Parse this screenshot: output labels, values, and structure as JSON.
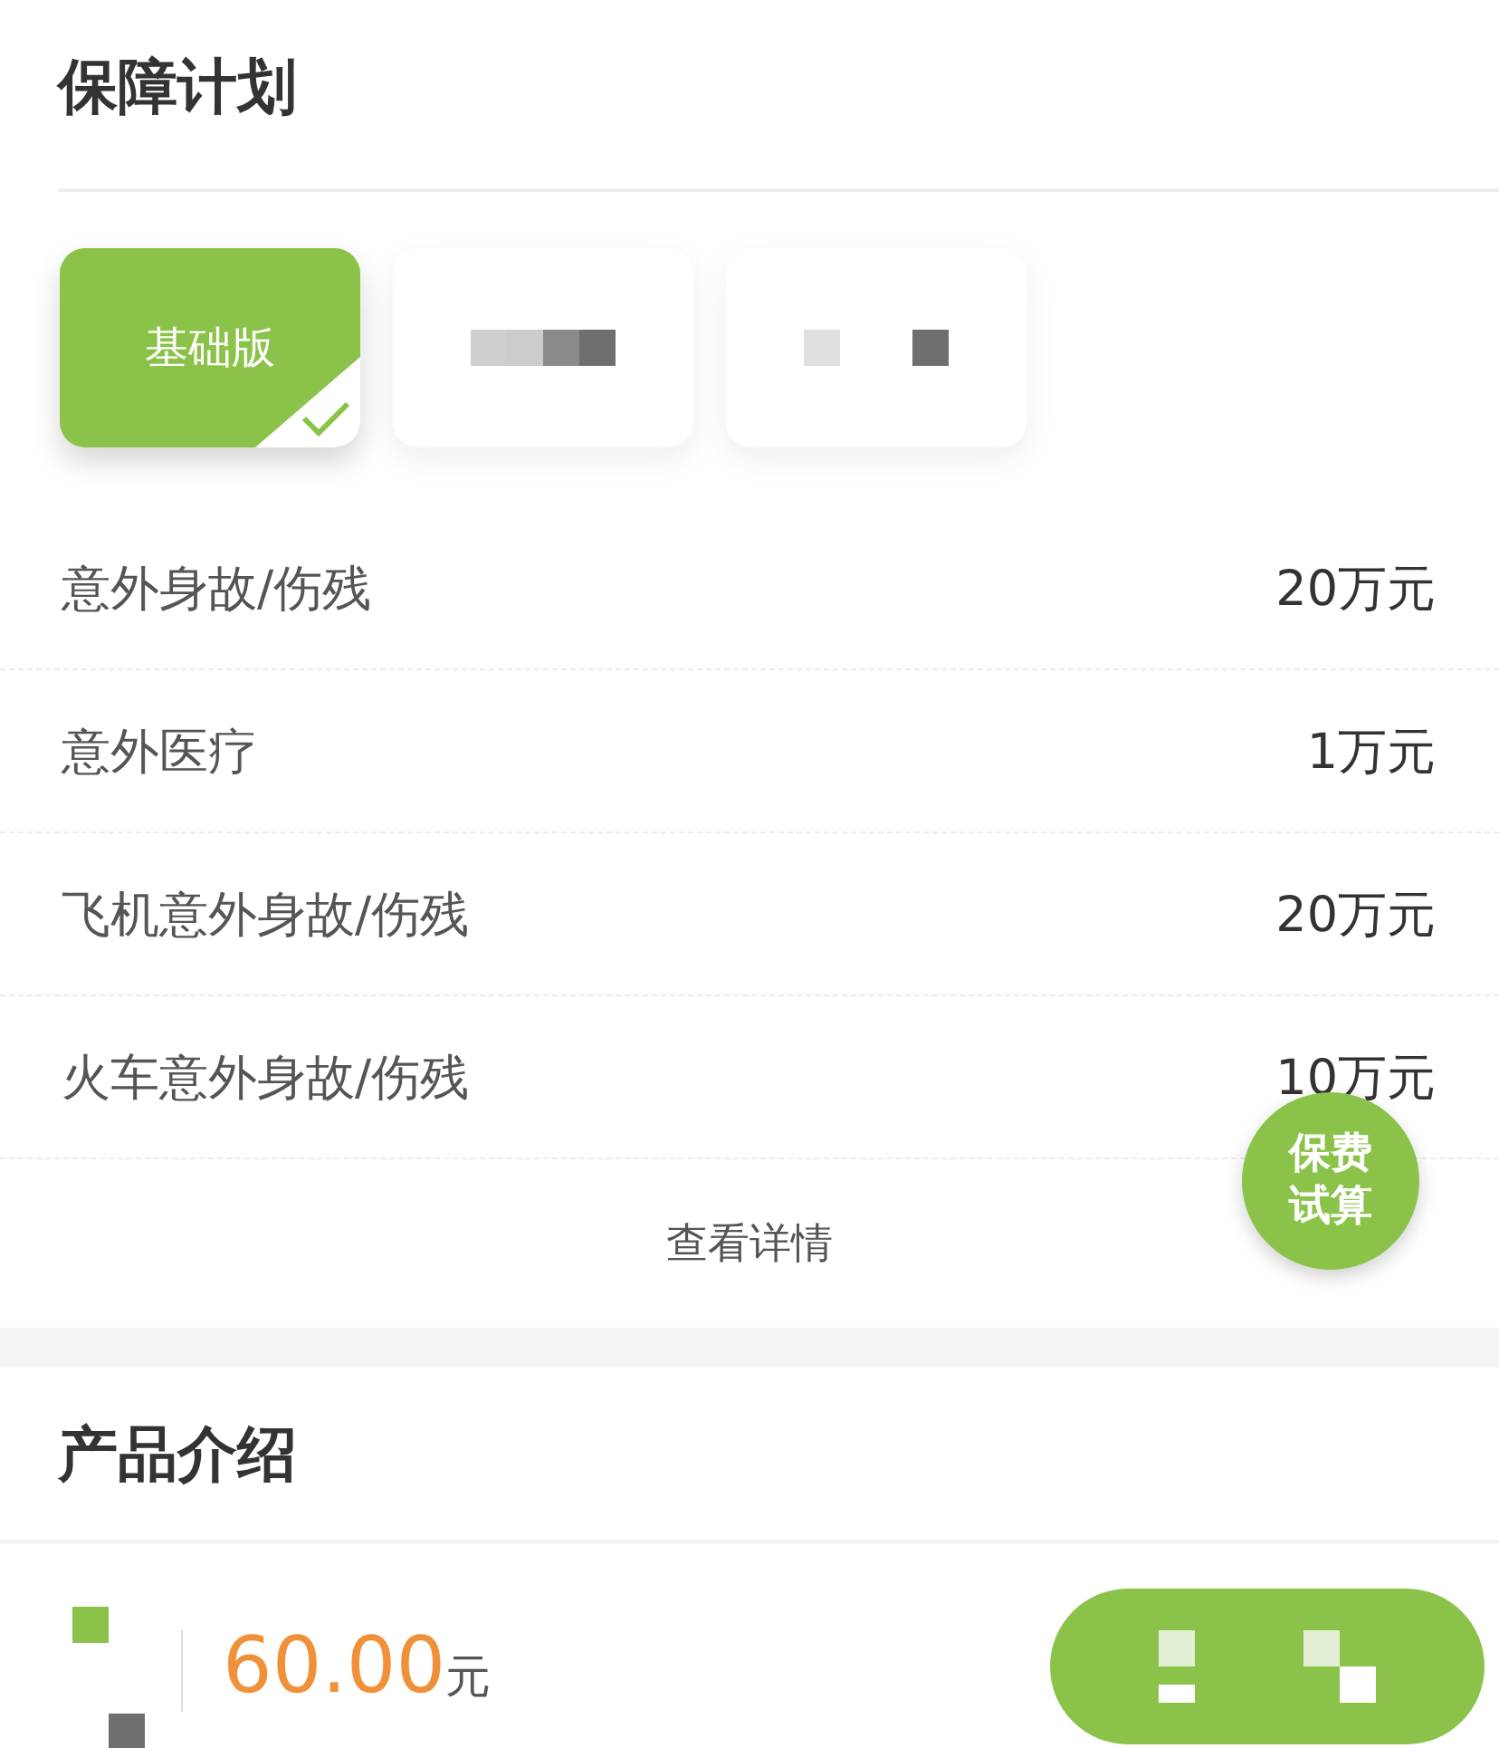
{
  "plan_section": {
    "title": "保障计划"
  },
  "plans": [
    {
      "kind": "text",
      "label": "基础版",
      "selected": true
    },
    {
      "kind": "pixelated",
      "selected": false
    },
    {
      "kind": "pixelated",
      "selected": false
    }
  ],
  "coverage": [
    {
      "item": "意外身故/伤残",
      "amount": "20万元"
    },
    {
      "item": "意外医疗",
      "amount": "1万元"
    },
    {
      "item": "飞机意外身故/伤残",
      "amount": "20万元"
    },
    {
      "item": "火车意外身故/伤残",
      "amount": "10万元"
    }
  ],
  "details_link": "查看详情",
  "quote_button": "保费试算",
  "intro_section": {
    "title": "产品介绍"
  },
  "bottom_bar": {
    "price": "60.00",
    "unit": "元"
  }
}
